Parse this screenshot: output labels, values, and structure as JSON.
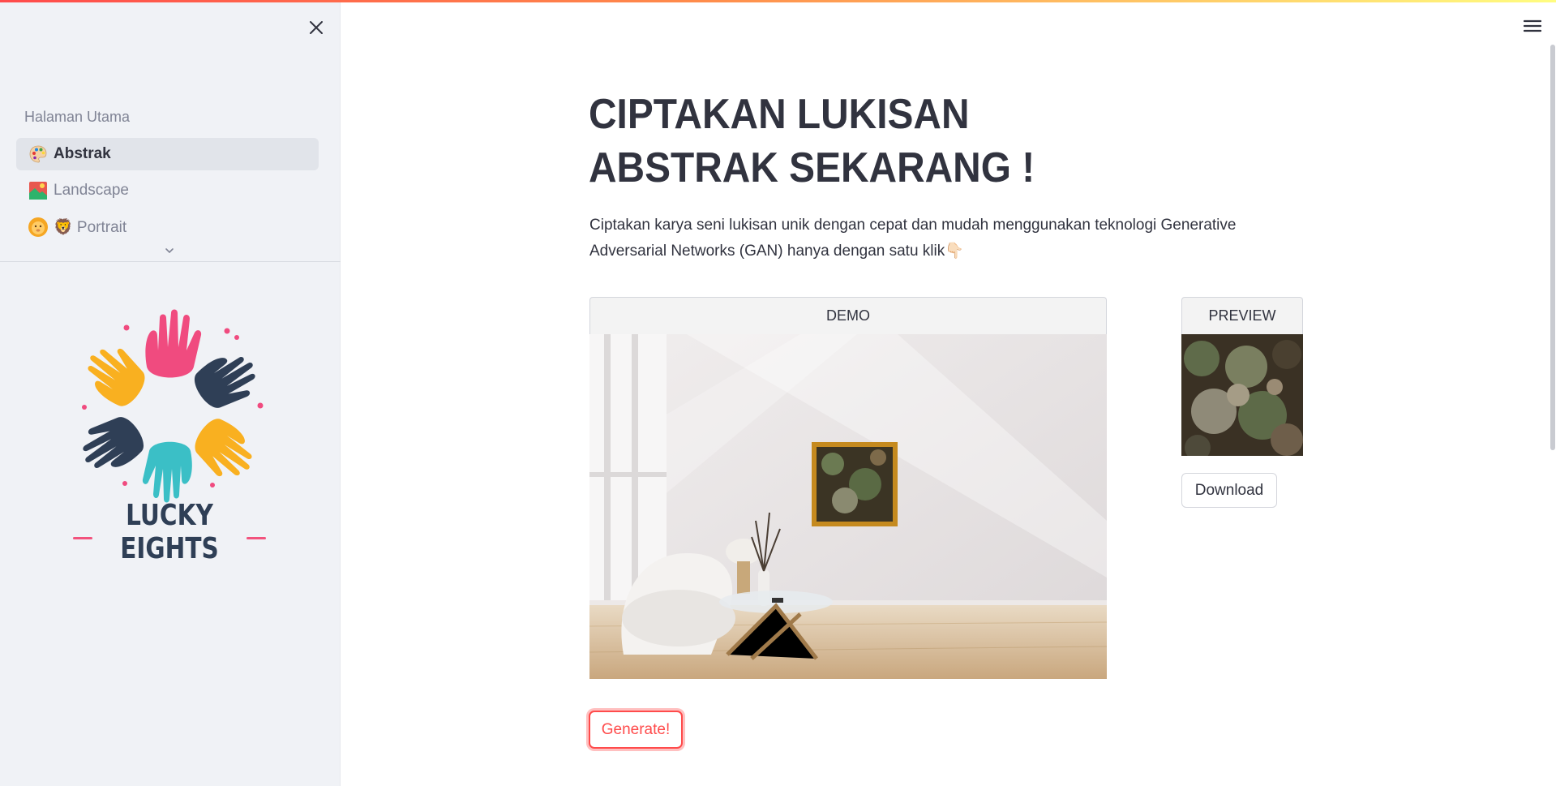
{
  "sidebar": {
    "close_icon": "close-icon",
    "nav_header": "Halaman Utama",
    "items": [
      {
        "label": "Abstrak",
        "icon": "palette-icon",
        "active": true
      },
      {
        "label": "Landscape",
        "icon": "landscape-picture-icon",
        "active": false
      },
      {
        "label": "🦁 Portrait",
        "icon": "lion-face-icon",
        "active": false
      }
    ],
    "more_icon": "chevron-down-icon",
    "logo": {
      "text": "LUCKY EIGHTS",
      "icon": "hands-circle-logo"
    }
  },
  "main": {
    "menu_icon": "hamburger-menu-icon",
    "title": "CIPTAKAN LUKISAN ABSTRAK SEKARANG !",
    "description": "Ciptakan karya seni lukisan unik dengan cepat dan mudah menggunakan teknologi Generative Adversarial Networks (GAN) hanya dengan satu klik👇🏻",
    "demo_tab": "DEMO",
    "preview_tab": "PREVIEW",
    "download_label": "Download",
    "generate_label": "Generate!"
  },
  "colors": {
    "accent": "#ff4b4b",
    "sidebar_bg": "#f0f2f6",
    "text": "#31333f"
  }
}
